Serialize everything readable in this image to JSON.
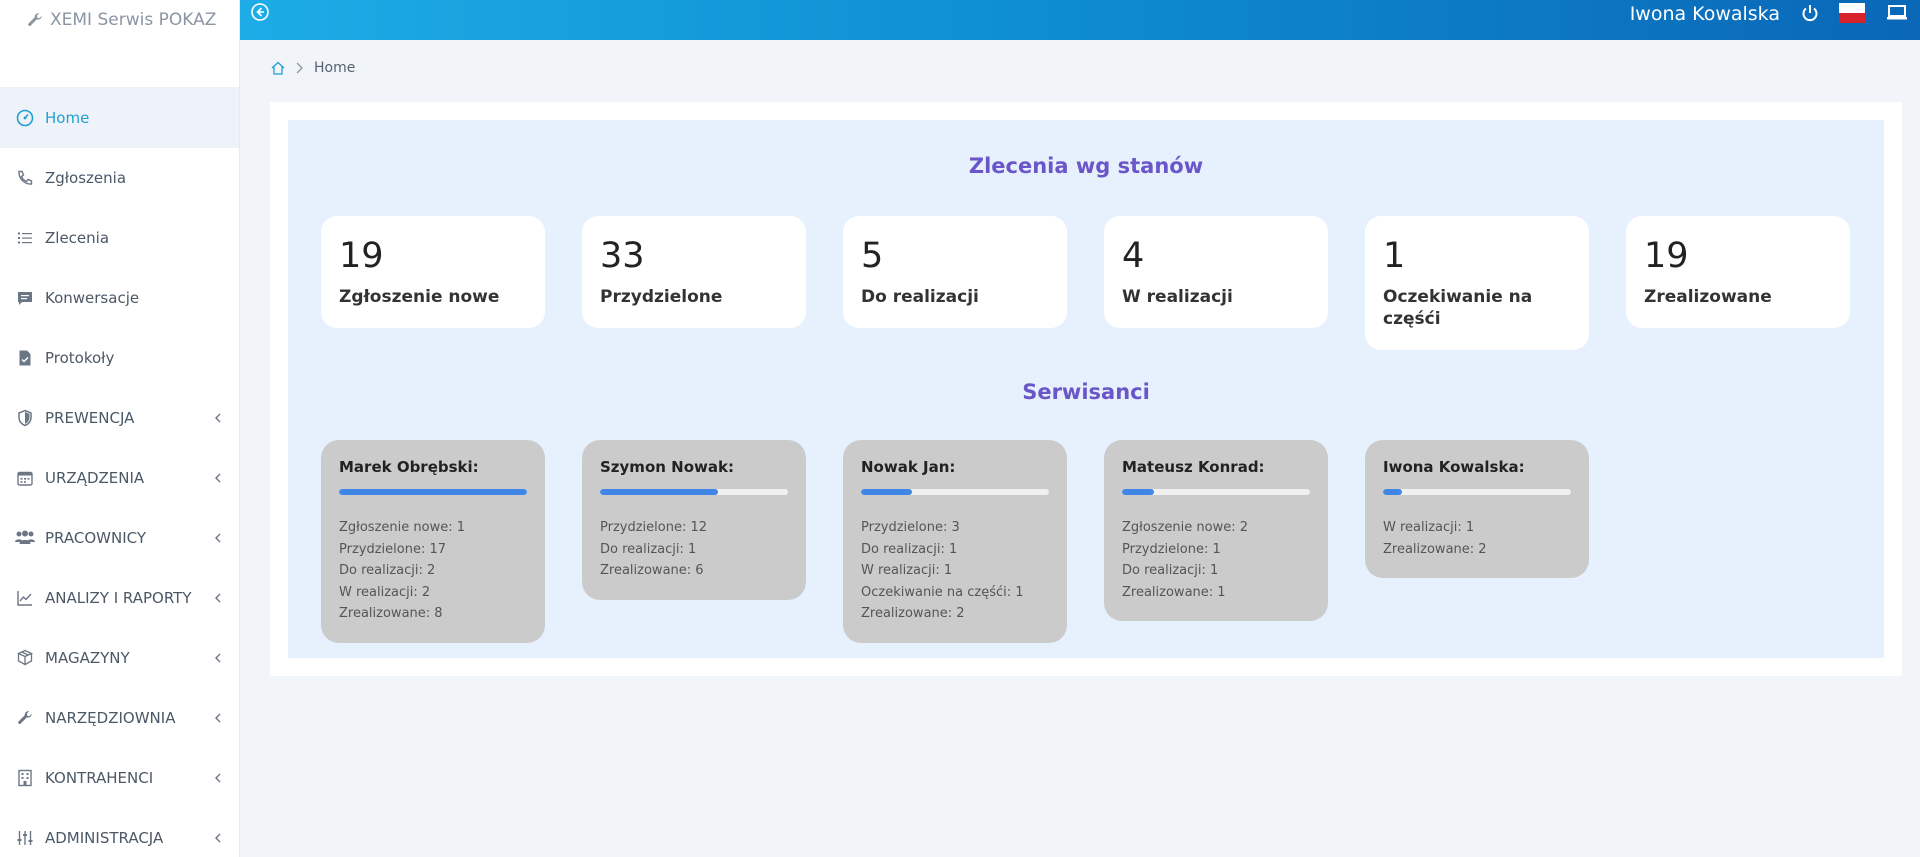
{
  "app": {
    "brand": "XEMI Serwis POKAZ"
  },
  "sidebar": {
    "items": [
      {
        "label": "Home",
        "icon": "dashboard-icon",
        "active": true,
        "has_children": false
      },
      {
        "label": "Zgłoszenia",
        "icon": "phone-icon",
        "active": false,
        "has_children": false
      },
      {
        "label": "Zlecenia",
        "icon": "list-icon",
        "active": false,
        "has_children": false
      },
      {
        "label": "Konwersacje",
        "icon": "chat-icon",
        "active": false,
        "has_children": false
      },
      {
        "label": "Protokoły",
        "icon": "document-icon",
        "active": false,
        "has_children": false
      },
      {
        "label": "PREWENCJA",
        "icon": "shield-icon",
        "active": false,
        "has_children": true
      },
      {
        "label": "URZĄDZENIA",
        "icon": "calendar-icon",
        "active": false,
        "has_children": true
      },
      {
        "label": "PRACOWNICY",
        "icon": "users-icon",
        "active": false,
        "has_children": true
      },
      {
        "label": "ANALIZY I RAPORTY",
        "icon": "chart-icon",
        "active": false,
        "has_children": true
      },
      {
        "label": "MAGAZYNY",
        "icon": "boxes-icon",
        "active": false,
        "has_children": true
      },
      {
        "label": "NARZĘDZIOWNIA",
        "icon": "wrench-icon",
        "active": false,
        "has_children": true
      },
      {
        "label": "KONTRAHENCI",
        "icon": "building-icon",
        "active": false,
        "has_children": true
      },
      {
        "label": "ADMINISTRACJA",
        "icon": "sliders-icon",
        "active": false,
        "has_children": true
      }
    ]
  },
  "topbar": {
    "user_name": "Iwona Kowalska",
    "icons": [
      "collapse-icon",
      "power-icon",
      "flag-poland-icon",
      "screen-icon"
    ]
  },
  "breadcrumb": {
    "current": "Home"
  },
  "orders": {
    "title": "Zlecenia wg stanów",
    "stats": [
      {
        "value": "19",
        "label": "Zgłoszenie nowe"
      },
      {
        "value": "33",
        "label": "Przydzielone"
      },
      {
        "value": "5",
        "label": "Do realizacji"
      },
      {
        "value": "4",
        "label": "W realizacji"
      },
      {
        "value": "1",
        "label": "Oczekiwanie na częśći"
      },
      {
        "value": "19",
        "label": "Zrealizowane"
      }
    ]
  },
  "technicians": {
    "title": "Serwisanci",
    "items": [
      {
        "name": "Marek Obrębski:",
        "progress": 1.0,
        "lines": [
          "Zgłoszenie nowe: 1",
          "Przydzielone: 17",
          "Do realizacji: 2",
          "W realizacji: 2",
          "Zrealizowane: 8"
        ]
      },
      {
        "name": "Szymon Nowak:",
        "progress": 0.63,
        "lines": [
          "Przydzielone: 12",
          "Do realizacji: 1",
          "Zrealizowane: 6"
        ]
      },
      {
        "name": "Nowak Jan:",
        "progress": 0.27,
        "lines": [
          "Przydzielone: 3",
          "Do realizacji: 1",
          "W realizacji: 1",
          "Oczekiwanie na częśći: 1",
          "Zrealizowane: 2"
        ]
      },
      {
        "name": "Mateusz Konrad:",
        "progress": 0.17,
        "lines": [
          "Zgłoszenie nowe: 2",
          "Przydzielone: 1",
          "Do realizacji: 1",
          "Zrealizowane: 1"
        ]
      },
      {
        "name": "Iwona Kowalska:",
        "progress": 0.1,
        "lines": [
          "W realizacji: 1",
          "Zrealizowane: 2"
        ]
      }
    ]
  },
  "colors": {
    "accent": "#1f9fd4",
    "title_purple": "#6a56c9",
    "progress_blue": "#3f86e6",
    "panel_bg": "#e6f1fd",
    "tech_card_bg": "#cbcbcb"
  }
}
